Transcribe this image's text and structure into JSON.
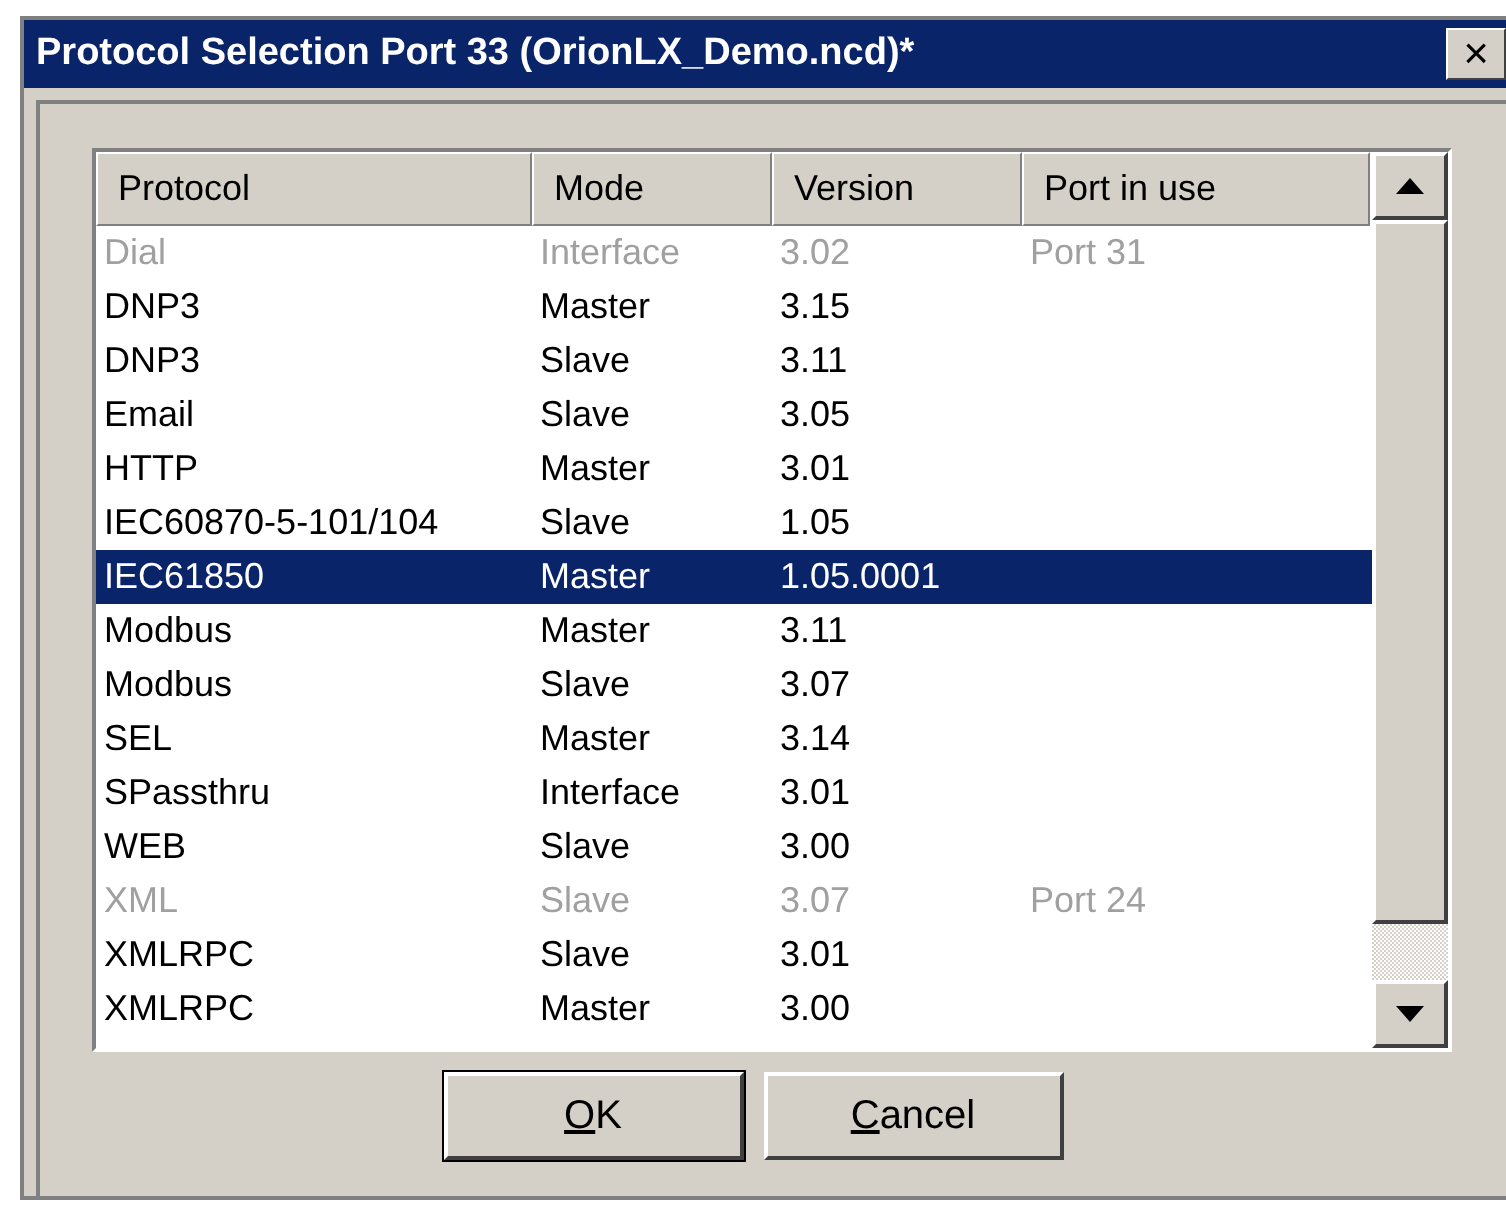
{
  "window": {
    "title": "Protocol Selection Port 33 (OrionLX_Demo.ncd)*",
    "close": "×"
  },
  "table": {
    "columns": [
      "Protocol",
      "Mode",
      "Version",
      "Port in use"
    ],
    "rows": [
      {
        "cells": [
          "Dial",
          "Interface",
          "3.02",
          "Port 31"
        ],
        "disabled": true,
        "selected": false
      },
      {
        "cells": [
          "DNP3",
          "Master",
          "3.15",
          ""
        ],
        "disabled": false,
        "selected": false
      },
      {
        "cells": [
          "DNP3",
          "Slave",
          "3.11",
          ""
        ],
        "disabled": false,
        "selected": false
      },
      {
        "cells": [
          "Email",
          "Slave",
          "3.05",
          ""
        ],
        "disabled": false,
        "selected": false
      },
      {
        "cells": [
          "HTTP",
          "Master",
          "3.01",
          ""
        ],
        "disabled": false,
        "selected": false
      },
      {
        "cells": [
          "IEC60870-5-101/104",
          "Slave",
          "1.05",
          ""
        ],
        "disabled": false,
        "selected": false
      },
      {
        "cells": [
          "IEC61850",
          "Master",
          "1.05.0001",
          ""
        ],
        "disabled": false,
        "selected": true
      },
      {
        "cells": [
          "Modbus",
          "Master",
          "3.11",
          ""
        ],
        "disabled": false,
        "selected": false
      },
      {
        "cells": [
          "Modbus",
          "Slave",
          "3.07",
          ""
        ],
        "disabled": false,
        "selected": false
      },
      {
        "cells": [
          "SEL",
          "Master",
          "3.14",
          ""
        ],
        "disabled": false,
        "selected": false
      },
      {
        "cells": [
          "SPassthru",
          "Interface",
          "3.01",
          ""
        ],
        "disabled": false,
        "selected": false
      },
      {
        "cells": [
          "WEB",
          "Slave",
          "3.00",
          ""
        ],
        "disabled": false,
        "selected": false
      },
      {
        "cells": [
          "XML",
          "Slave",
          "3.07",
          "Port 24"
        ],
        "disabled": true,
        "selected": false
      },
      {
        "cells": [
          "XMLRPC",
          "Slave",
          "3.01",
          ""
        ],
        "disabled": false,
        "selected": false
      },
      {
        "cells": [
          "XMLRPC",
          "Master",
          "3.00",
          ""
        ],
        "disabled": false,
        "selected": false
      }
    ]
  },
  "buttons": [
    {
      "access_key": "O",
      "label_rest": "K",
      "default": true
    },
    {
      "access_key": "C",
      "label_rest": "ancel",
      "default": false
    }
  ]
}
